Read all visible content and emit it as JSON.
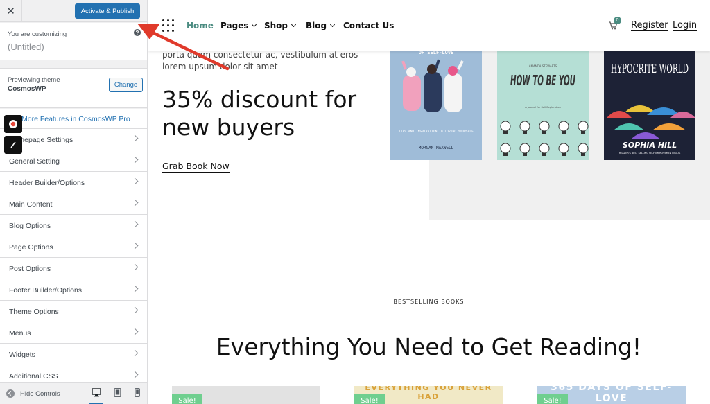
{
  "customizer": {
    "close_icon": "close-icon",
    "publish_label": "Activate & Publish",
    "customizing_label": "You are customizing",
    "site_title": "(Untitled)",
    "help_icon": "help-icon",
    "previewing_label": "Previewing theme",
    "theme_name": "CosmosWP",
    "change_label": "Change",
    "pro_link_label": "More Features in CosmosWP Pro",
    "menu_items": [
      {
        "label": "Homepage Settings"
      },
      {
        "label": "General Setting"
      },
      {
        "label": "Header Builder/Options"
      },
      {
        "label": "Main Content"
      },
      {
        "label": "Blog Options"
      },
      {
        "label": "Page Options"
      },
      {
        "label": "Post Options"
      },
      {
        "label": "Footer Builder/Options"
      },
      {
        "label": "Theme Options"
      },
      {
        "label": "Menus"
      },
      {
        "label": "Widgets"
      },
      {
        "label": "Additional CSS"
      }
    ],
    "hide_controls_label": "Hide Controls",
    "devices": [
      "desktop-icon",
      "tablet-icon",
      "mobile-icon"
    ],
    "accent_color": "#2271b1"
  },
  "site": {
    "nav": {
      "items": [
        {
          "label": "Home",
          "active": true
        },
        {
          "label": "Pages",
          "dropdown": true
        },
        {
          "label": "Shop",
          "dropdown": true
        },
        {
          "label": "Blog",
          "dropdown": true
        },
        {
          "label": "Contact Us"
        }
      ],
      "cart_count": "0",
      "register_label": "Register",
      "login_label": "Login",
      "accent_color": "#4a8b80"
    },
    "hero": {
      "promo_text": "porta quam consectetur ac, vestibulum at eros lorem upsum dolor sit amet",
      "title": "35% discount for new buyers",
      "cta_label": "Grab Book Now",
      "books": [
        {
          "title_top": "OF SELF-LOVE",
          "subtitle": "TIPS AND INSPIRATION TO LOVING YOURSELF",
          "author": "MORGAN MAXWELL"
        },
        {
          "author_top": "AMANDA STEWARTS",
          "title": "HOW TO BE YOU",
          "subtitle": "A Journal for Self-Exploration"
        },
        {
          "title": "HYPOCRITE WORLD",
          "author": "SOPHIA HILL",
          "subtitle": "READER'S BEST SELLING SELF IMPROVEMENT BOOK"
        }
      ]
    },
    "bestselling_label": "BESTSELLING BOOKS",
    "section_title": "Everything You Need to Get Reading!",
    "products": [
      {
        "badge": "Sale!",
        "cover_text": ""
      },
      {
        "badge": "Sale!",
        "cover_text": "EVERYTHING YOU NEVER HAD"
      },
      {
        "badge": "Sale!",
        "cover_text": "365 DAYS OF SELF-LOVE"
      }
    ],
    "sale_color": "#6fcf8f"
  }
}
